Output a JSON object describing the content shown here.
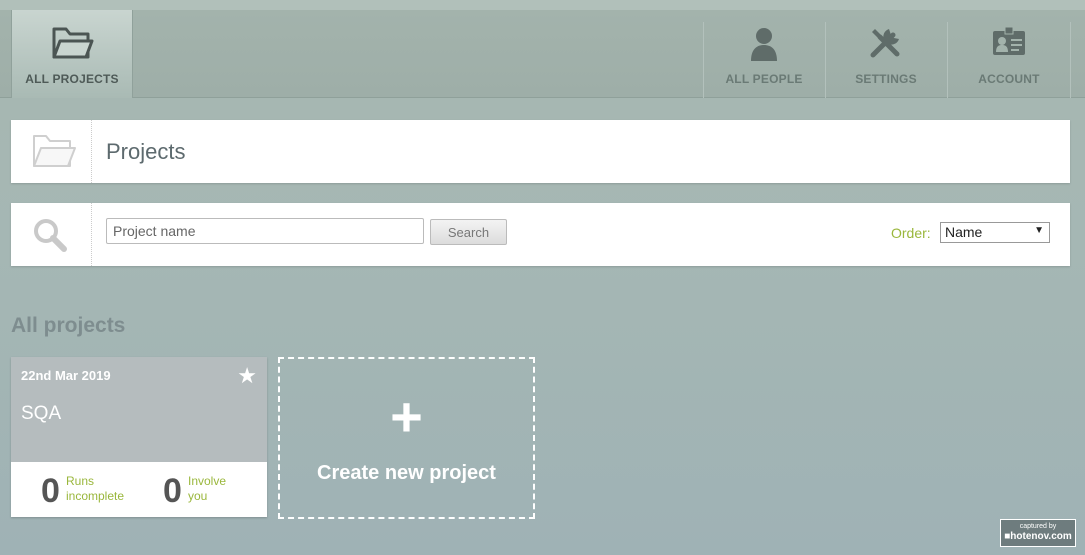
{
  "nav": {
    "all_projects": "ALL PROJECTS",
    "all_people": "ALL PEOPLE",
    "settings": "SETTINGS",
    "account": "ACCOUNT",
    "icons": [
      "folder-icon",
      "person-icon",
      "tools-icon",
      "id-card-icon"
    ]
  },
  "header": {
    "title": "Projects"
  },
  "search": {
    "placeholder": "Project name",
    "button_label": "Search",
    "order_label": "Order:",
    "order_value": "Name"
  },
  "section": {
    "title": "All projects"
  },
  "projects": [
    {
      "date": "22nd Mar 2019",
      "name": "SQA",
      "starred": true,
      "runs_count": "0",
      "runs_label_1": "Runs",
      "runs_label_2": "incomplete",
      "involve_count": "0",
      "involve_label_1": "Involve",
      "involve_label_2": "you"
    }
  ],
  "create": {
    "plus": "+",
    "label": "Create new project"
  },
  "watermark": {
    "line1": "captured by",
    "line2": "■hotenov.com"
  },
  "colors": {
    "accent_green": "#9ab73c",
    "background": "#a5b7b4",
    "card_top": "#b5bcbe"
  }
}
